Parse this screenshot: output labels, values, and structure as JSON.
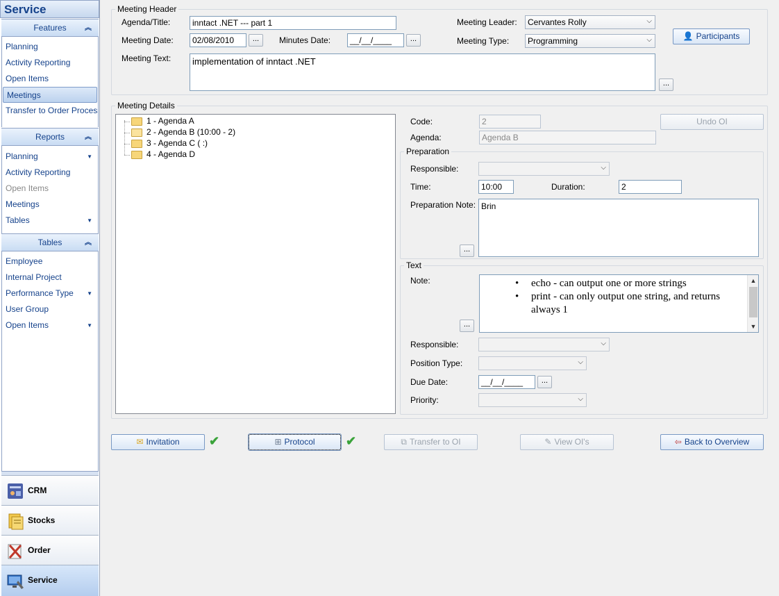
{
  "sidebar": {
    "title": "Service",
    "sections": [
      {
        "title": "Features",
        "items": [
          {
            "label": "Planning"
          },
          {
            "label": "Activity Reporting"
          },
          {
            "label": "Open Items"
          },
          {
            "label": "Meetings"
          },
          {
            "label": "Transfer to Order Processing"
          }
        ]
      },
      {
        "title": "Reports",
        "items": [
          {
            "label": "Planning"
          },
          {
            "label": "Activity Reporting"
          },
          {
            "label": "Open Items"
          },
          {
            "label": "Meetings"
          },
          {
            "label": "Tables"
          }
        ]
      },
      {
        "title": "Tables",
        "items": [
          {
            "label": "Employee"
          },
          {
            "label": "Internal Project"
          },
          {
            "label": "Performance Type"
          },
          {
            "label": "User Group"
          },
          {
            "label": "Open Items"
          }
        ]
      }
    ],
    "modules": [
      {
        "label": "CRM"
      },
      {
        "label": "Stocks"
      },
      {
        "label": "Order"
      },
      {
        "label": "Service"
      }
    ]
  },
  "header": {
    "legend": "Meeting Header",
    "agenda_label": "Agenda/Title:",
    "agenda_value": "inntact .NET --- part 1",
    "meeting_date_label": "Meeting Date:",
    "meeting_date_value": "02/08/2010",
    "minutes_date_label": "Minutes Date:",
    "minutes_date_value": "__/__/____",
    "meeting_text_label": "Meeting Text:",
    "meeting_text_value": "implementation of inntact .NET",
    "leader_label": "Meeting Leader:",
    "leader_value": "Cervantes Rolly",
    "type_label": "Meeting Type:",
    "type_value": "Programming",
    "participants_label": "Participants",
    "ellipsis": "..."
  },
  "details": {
    "legend": "Meeting Details",
    "tree": [
      {
        "label": "1 - Agenda A"
      },
      {
        "label": "2 - Agenda B (10:00 - 2)"
      },
      {
        "label": "3 - Agenda C (  :)"
      },
      {
        "label": "4 - Agenda D"
      }
    ],
    "code_label": "Code:",
    "code_value": "2",
    "agenda_label": "Agenda:",
    "agenda_value": "Agenda B",
    "undo_label": "Undo OI",
    "preparation": {
      "legend": "Preparation",
      "responsible_label": "Responsible:",
      "time_label": "Time:",
      "time_value": "10:00",
      "duration_label": "Duration:",
      "duration_value": "2",
      "note_label": "Preparation Note:",
      "note_value": "Brin"
    },
    "text": {
      "legend": "Text",
      "note_label": "Note:",
      "bullets": [
        "echo - can output one or more strings",
        "print - can only output one string, and returns always 1"
      ],
      "bullet_char": "•",
      "responsible_label": "Responsible:",
      "position_type_label": "Position Type:",
      "due_date_label": "Due Date:",
      "due_date_value": "__/__/____",
      "priority_label": "Priority:"
    }
  },
  "actions": {
    "invitation": "Invitation",
    "protocol": "Protocol",
    "transfer": "Transfer to OI",
    "view_ois": "View OI's",
    "back": "Back to Overview",
    "check": "✔"
  }
}
